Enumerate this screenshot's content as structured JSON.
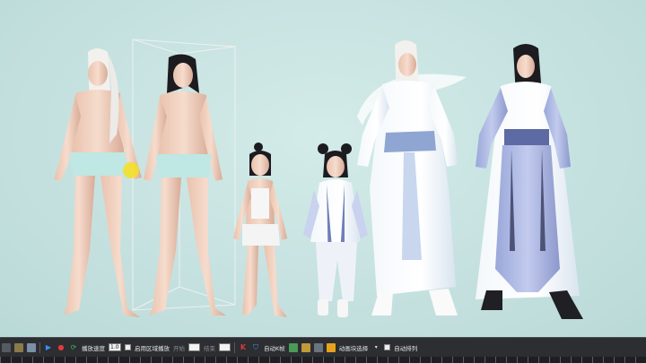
{
  "scene": {
    "background": "#c5e2e0",
    "characters": [
      {
        "name": "white-haired-male-base"
      },
      {
        "name": "dark-haired-male-base"
      },
      {
        "name": "child-girl-base"
      },
      {
        "name": "child-girl-robe"
      },
      {
        "name": "white-haired-male-robe"
      },
      {
        "name": "dark-haired-male-robe"
      }
    ]
  },
  "toolbar": {
    "play_speed_label": "播放速度",
    "play_speed_value": "1.0",
    "enable_range_label": "启用区域播放",
    "start_label": "开始",
    "end_label": "结束",
    "auto_key_label": "自动K帧",
    "anim_select_label": "动画块选择",
    "auto_sort_label": "自动排列",
    "colors": {
      "play": "#3d8bff",
      "record": "#e23b3b",
      "loop": "#2fbf5a",
      "key": "#d83a3a",
      "lock": "#e6a21c"
    }
  }
}
